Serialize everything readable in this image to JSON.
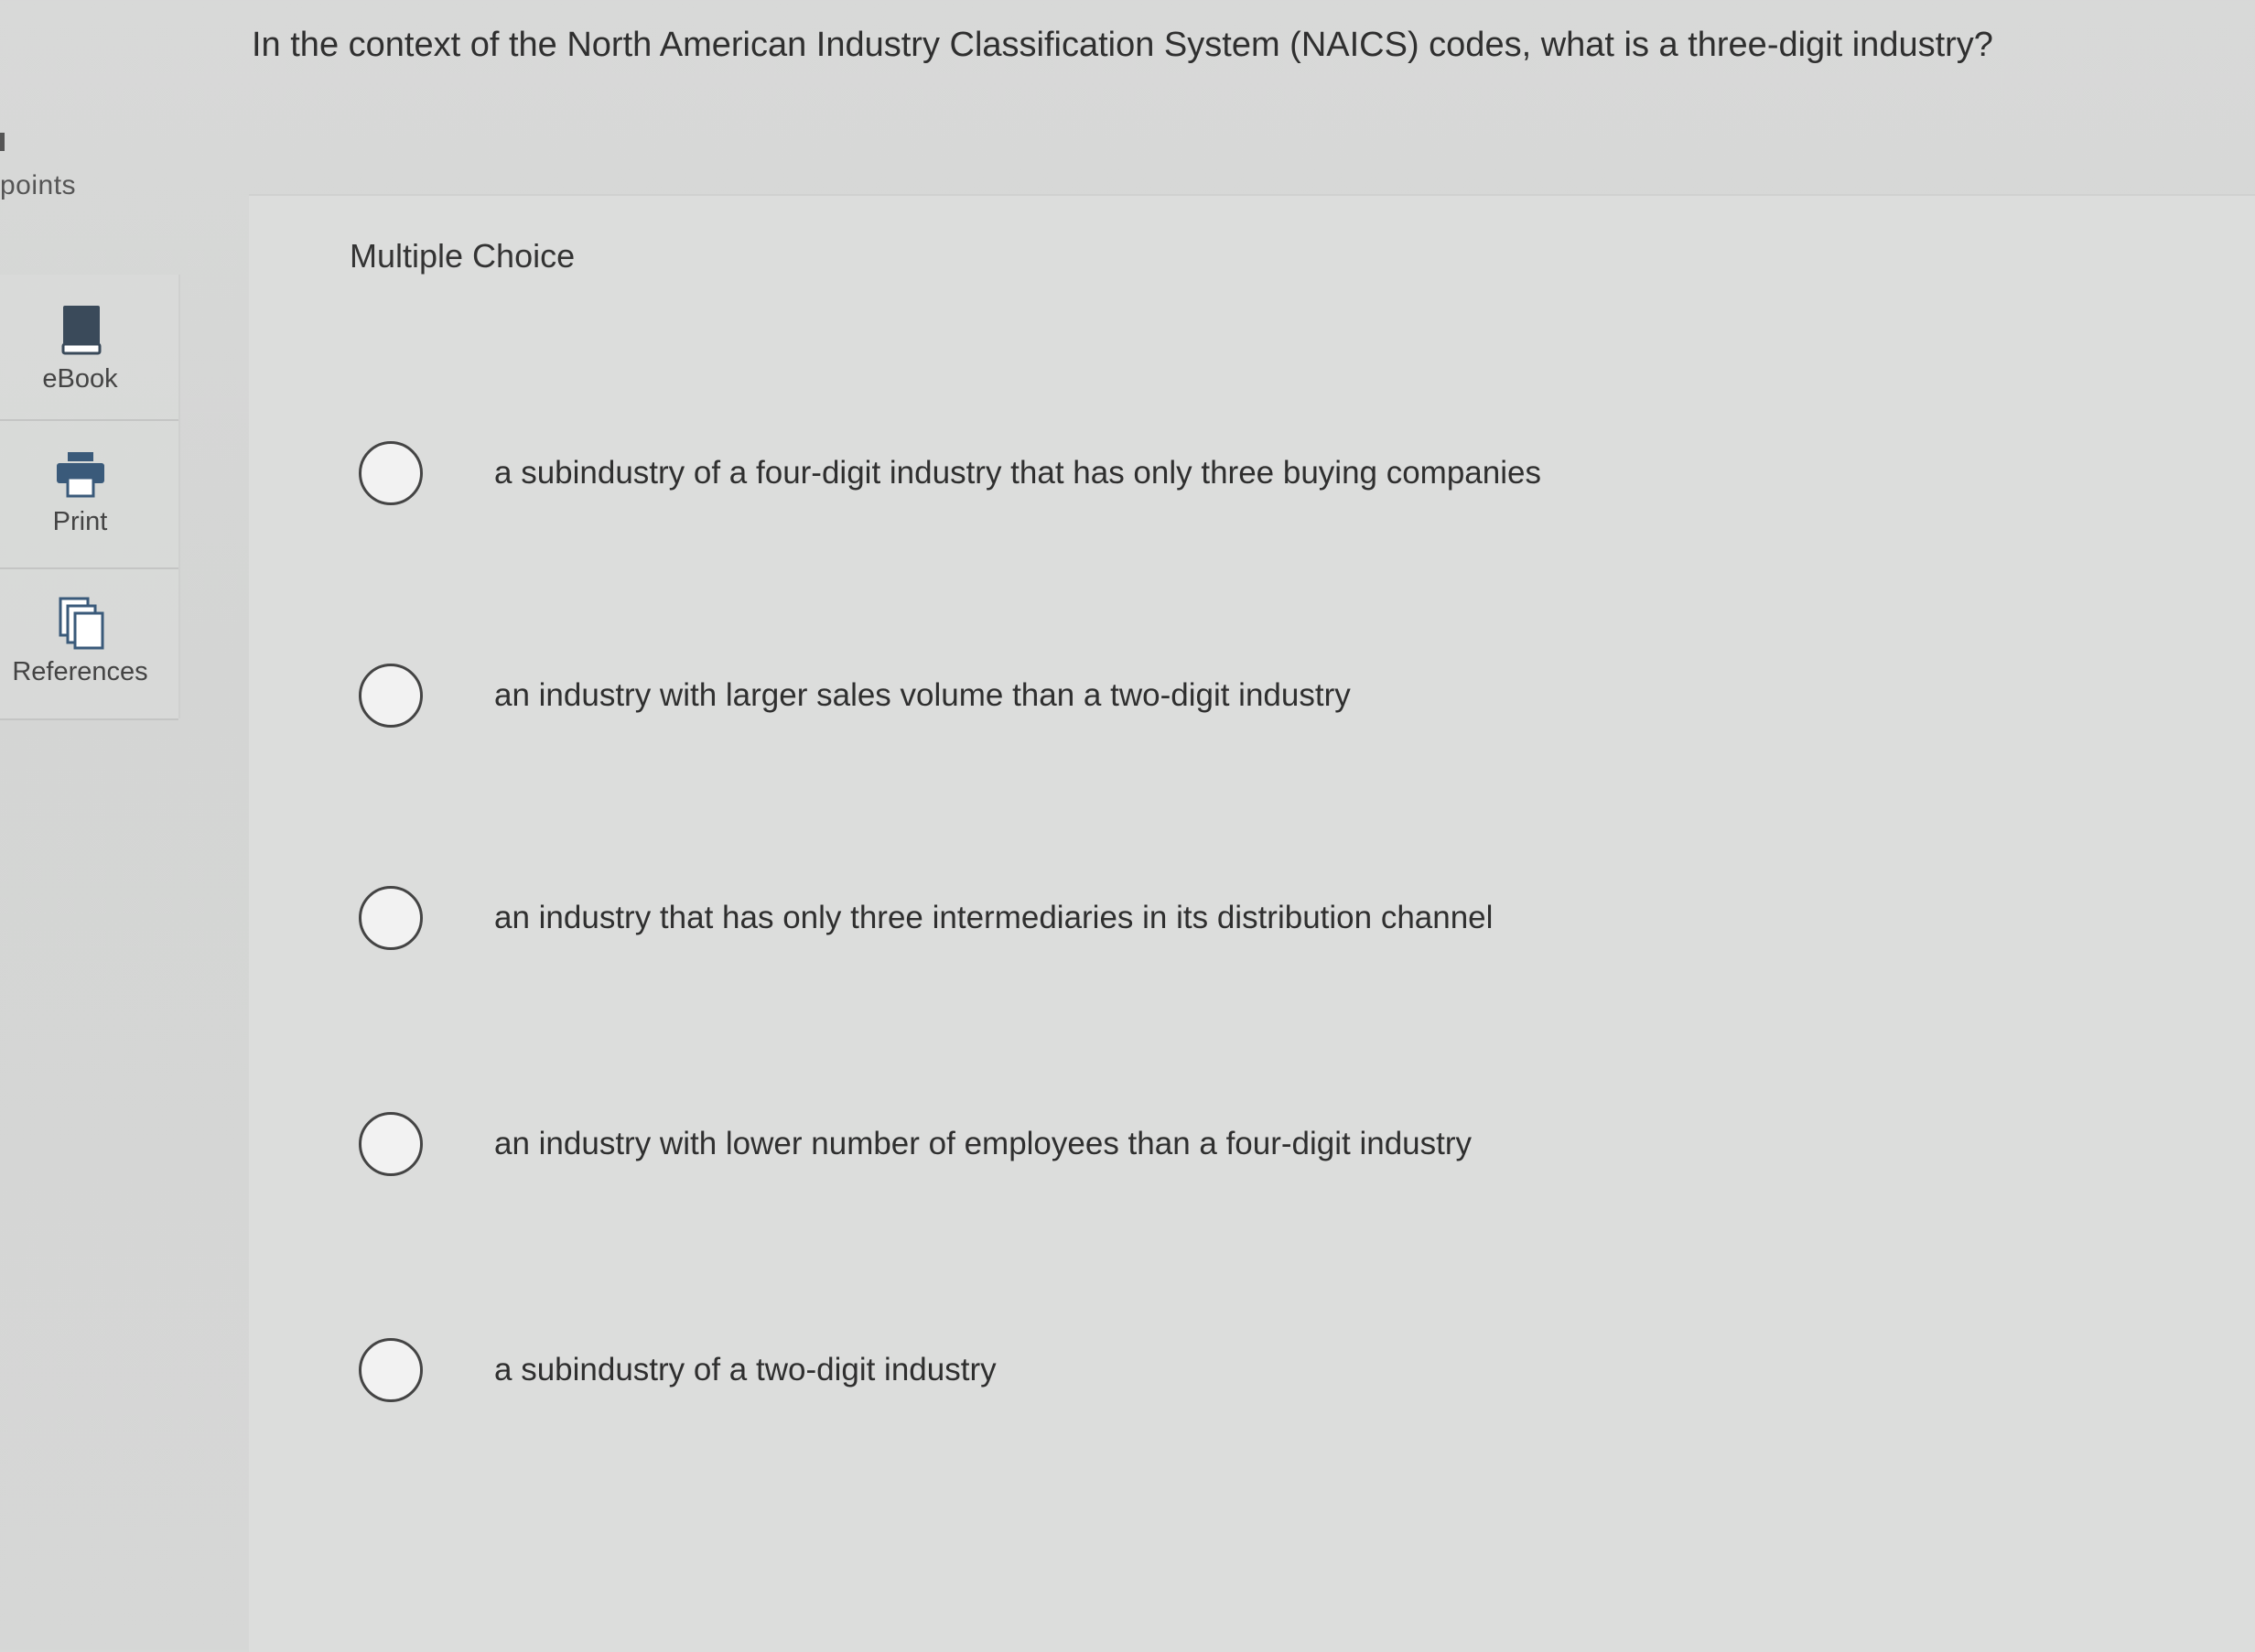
{
  "sidebar": {
    "points_label": "points",
    "tools": [
      {
        "label": "eBook",
        "icon": "book-icon"
      },
      {
        "label": "Print",
        "icon": "printer-icon"
      },
      {
        "label": "References",
        "icon": "references-icon"
      }
    ]
  },
  "question": {
    "text": "In the context of the North American Industry Classification System (NAICS) codes, what is a three-digit industry?"
  },
  "card": {
    "title": "Multiple Choice",
    "choices": [
      "a subindustry of a four-digit industry that has only three buying companies",
      "an industry with larger sales volume than a two-digit industry",
      "an industry that has only three intermediaries in its distribution channel",
      "an industry with lower number of employees than a four-digit industry",
      "a subindustry of a two-digit industry"
    ]
  },
  "colors": {
    "book_icon": "#3a4a5a",
    "printer_icon": "#3a5a7a",
    "references_icon": "#3a5a7a"
  }
}
